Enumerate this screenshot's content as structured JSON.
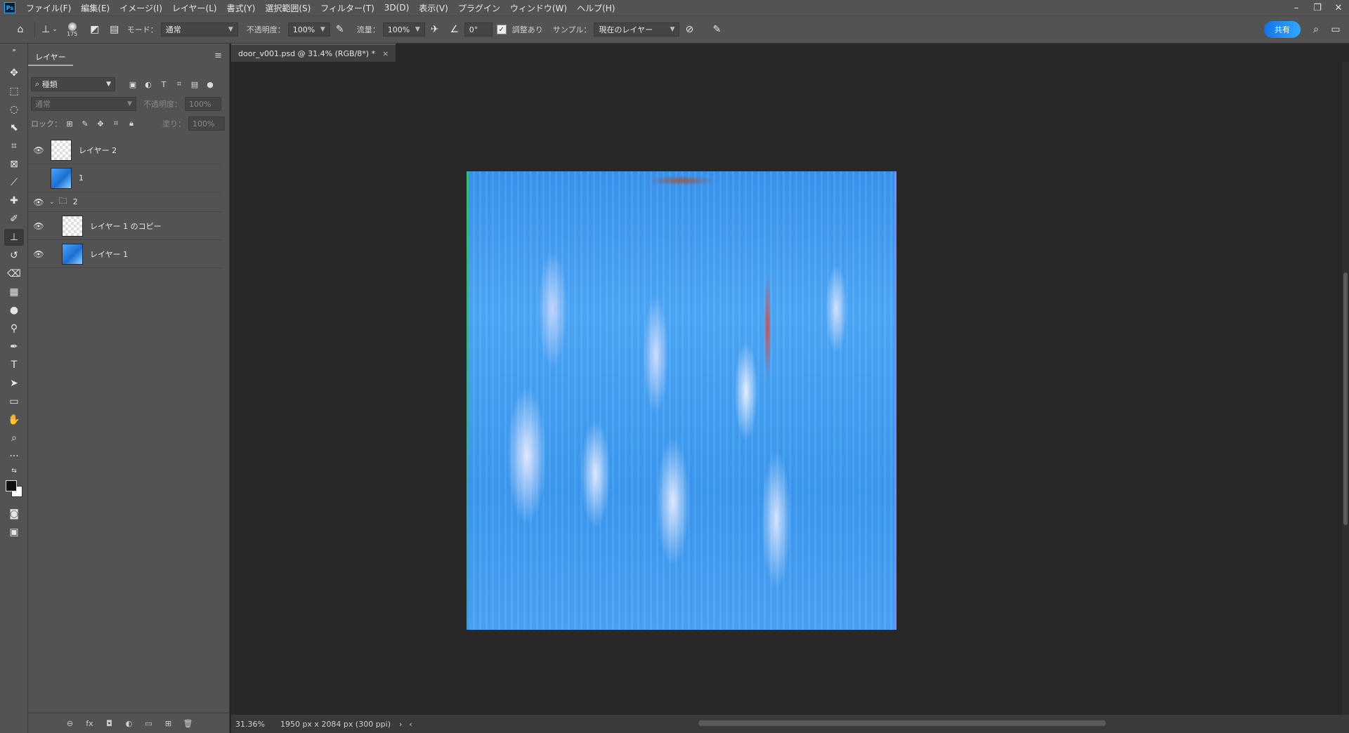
{
  "app": {
    "logo": "Ps"
  },
  "menu": [
    "ファイル(F)",
    "編集(E)",
    "イメージ(I)",
    "レイヤー(L)",
    "書式(Y)",
    "選択範囲(S)",
    "フィルター(T)",
    "3D(D)",
    "表示(V)",
    "プラグイン",
    "ウィンドウ(W)",
    "ヘルプ(H)"
  ],
  "window_controls": {
    "minimize": "–",
    "restore": "❐",
    "close": "✕"
  },
  "options": {
    "brush_size": "175",
    "mode_label": "モード：",
    "mode_value": "通常",
    "opacity_label": "不透明度：",
    "opacity_value": "100%",
    "flow_label": "流量：",
    "flow_value": "100%",
    "angle_value": "0°",
    "aligned_label": "調整あり",
    "sample_label": "サンプル：",
    "sample_value": "現在のレイヤー",
    "share_label": "共有"
  },
  "layers_panel": {
    "tab_label": "レイヤー",
    "kind_filter": "種類",
    "blend_mode": "通常",
    "opacity_label": "不透明度：",
    "opacity_value": "100%",
    "lock_label": "ロック：",
    "fill_label": "塗り：",
    "fill_value": "100%",
    "layers": [
      {
        "name": "レイヤー 2",
        "visible": true
      },
      {
        "name": "1",
        "visible": false
      },
      {
        "name": "2",
        "visible": true,
        "group": true
      },
      {
        "name": "レイヤー 1 のコピー",
        "visible": true
      },
      {
        "name": "レイヤー 1",
        "visible": true
      }
    ]
  },
  "document": {
    "tab_title": "door_v001.psd @ 31.4% (RGB/8*) *",
    "zoom": "31.36%",
    "doc_info": "1950 px x 2084 px (300 ppi)"
  },
  "colors": {
    "accent": "#31a8ff",
    "panel": "#535353",
    "canvas_bg": "#282828"
  }
}
